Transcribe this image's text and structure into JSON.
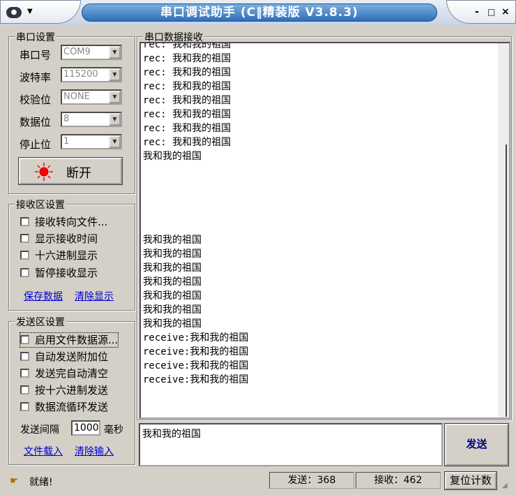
{
  "window": {
    "title": "串口调试助手 (C‖精装版 V3.8.3)",
    "min": "-",
    "max": "□",
    "close": "×"
  },
  "port_settings": {
    "legend": "串口设置",
    "fields": [
      {
        "label": "串口号",
        "value": "COM9"
      },
      {
        "label": "波特率",
        "value": "115200"
      },
      {
        "label": "校验位",
        "value": "NONE"
      },
      {
        "label": "数据位",
        "value": "8"
      },
      {
        "label": "停止位",
        "value": "1"
      }
    ],
    "toggle_label": "断开",
    "indicator_color": "#ff0000"
  },
  "recv_settings": {
    "legend": "接收区设置",
    "options": [
      "接收转向文件...",
      "显示接收时间",
      "十六进制显示",
      "暂停接收显示"
    ],
    "save_link": "保存数据",
    "clear_link": "清除显示"
  },
  "send_settings": {
    "legend": "发送区设置",
    "options": [
      "启用文件数据源...",
      "自动发送附加位",
      "发送完自动清空",
      "按十六进制发送",
      "数据流循环发送"
    ],
    "interval_label": "发送间隔",
    "interval_value": "1000",
    "interval_unit": "毫秒",
    "load_link": "文件载入",
    "clear_link": "清除输入"
  },
  "receive_area": {
    "legend": "串口数据接收",
    "lines": [
      "rec: 我和我的祖国",
      "rec: 我和我的祖国",
      "rec: 我和我的祖国",
      "rec: 我和我的祖国",
      "rec: 我和我的祖国",
      "rec: 我和我的祖国",
      "rec: 我和我的祖国",
      "rec: 我和我的祖国",
      "我和我的祖国",
      "我和我的祖国",
      "我和我的祖国",
      "我和我的祖国",
      "我和我的祖国",
      "我和我的祖国",
      "我和我的祖国",
      "我和我的祖国",
      "receive:我和我的祖国",
      "receive:我和我的祖国",
      "receive:我和我的祖国",
      "receive:我和我的祖国"
    ]
  },
  "send_area": {
    "text": "我和我的祖国",
    "send_button": "发送"
  },
  "status": {
    "ready": "就绪!",
    "sent": "发送：368",
    "received": "接收：462",
    "reset": "复位计数"
  }
}
